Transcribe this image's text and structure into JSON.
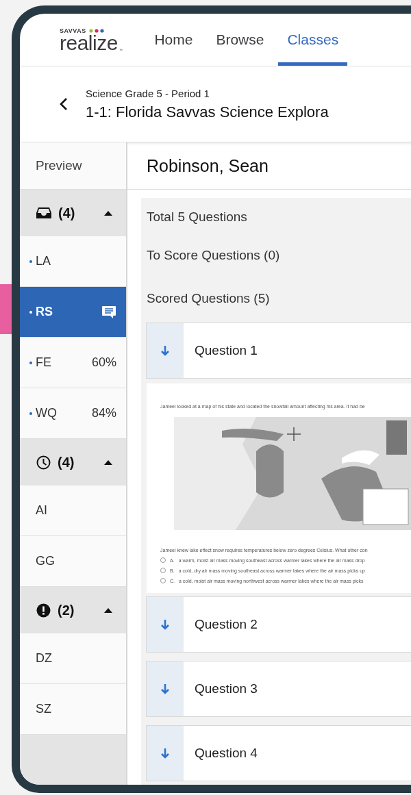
{
  "header": {
    "logo": {
      "brand": "SAVVAS",
      "product": "realize",
      "mark": "™"
    },
    "nav": [
      {
        "label": "Home",
        "selected": false
      },
      {
        "label": "Browse",
        "selected": false
      },
      {
        "label": "Classes",
        "selected": true
      }
    ]
  },
  "breadcrumb": {
    "subtitle": "Science Grade 5 - Period 1",
    "title": "1-1: Florida Savvas Science Explora"
  },
  "sidebar": {
    "preview_label": "Preview",
    "groups": [
      {
        "kind": "inbox",
        "count": "(4)",
        "expanded": true,
        "items": [
          {
            "label": "LA",
            "dot": true,
            "selected": false,
            "comment": false
          },
          {
            "label": "RS",
            "dot": true,
            "selected": true,
            "comment": true
          },
          {
            "label": "FE",
            "dot": true,
            "selected": false,
            "comment": false,
            "score": "60%"
          },
          {
            "label": "WQ",
            "dot": true,
            "selected": false,
            "comment": false,
            "score": "84%"
          }
        ]
      },
      {
        "kind": "clock",
        "count": "(4)",
        "expanded": true,
        "items": [
          {
            "label": "AI",
            "dot": false,
            "selected": false,
            "comment": false
          },
          {
            "label": "GG",
            "dot": false,
            "selected": false,
            "comment": false
          }
        ]
      },
      {
        "kind": "alert",
        "count": "(2)",
        "expanded": true,
        "items": [
          {
            "label": "DZ",
            "dot": false,
            "selected": false,
            "comment": false
          },
          {
            "label": "SZ",
            "dot": false,
            "selected": false,
            "comment": false
          }
        ]
      }
    ]
  },
  "student_name": "Robinson, Sean",
  "summary": [
    "Total 5 Questions",
    "To Score Questions (0)",
    "Scored Questions (5)"
  ],
  "questions": [
    {
      "label": "Question 1",
      "content": {
        "prompt": "Jameel looked at a map of his state and located the snowfall amount affecting his area. It had be",
        "question": "Jameel knew lake effect snow requires temperatures below zero degrees Celsius. What other con",
        "options": [
          {
            "letter": "A.",
            "text": "a warm, moist air mass moving southeast across warmer lakes where the air mass drop",
            "selected": false
          },
          {
            "letter": "B.",
            "text": "a cold, dry air mass moving southeast across warmer lakes where the air mass picks up",
            "selected": false
          },
          {
            "letter": "C.",
            "text": "a cold, moist air mass moving northwest across warmer lakes where the air mass picks",
            "selected": false
          }
        ]
      }
    },
    {
      "label": "Question 2"
    },
    {
      "label": "Question 3"
    },
    {
      "label": "Question 4"
    }
  ]
}
